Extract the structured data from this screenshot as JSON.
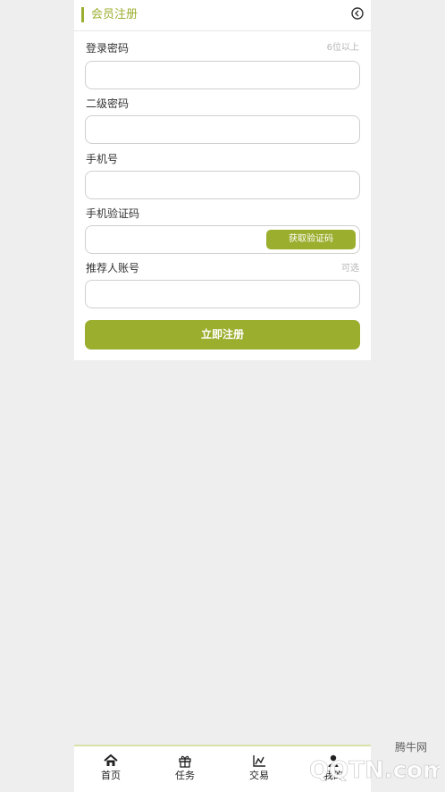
{
  "header": {
    "title": "会员注册"
  },
  "form": {
    "login_password": {
      "label": "登录密码",
      "hint": "6位以上"
    },
    "second_password": {
      "label": "二级密码"
    },
    "phone": {
      "label": "手机号"
    },
    "sms_code": {
      "label": "手机验证码",
      "button": "获取验证码"
    },
    "referrer": {
      "label": "推荐人账号",
      "hint": "可选"
    },
    "submit": "立即注册"
  },
  "tabbar": {
    "items": [
      {
        "label": "首页",
        "icon": "home-icon"
      },
      {
        "label": "任务",
        "icon": "gift-icon"
      },
      {
        "label": "交易",
        "icon": "chart-icon"
      },
      {
        "label": "我的",
        "icon": "user-icon"
      }
    ]
  },
  "watermark": {
    "text": "QQTN.com",
    "sub": "腾牛网"
  },
  "colors": {
    "accent": "#9cae2e",
    "background": "#eeeeef"
  }
}
